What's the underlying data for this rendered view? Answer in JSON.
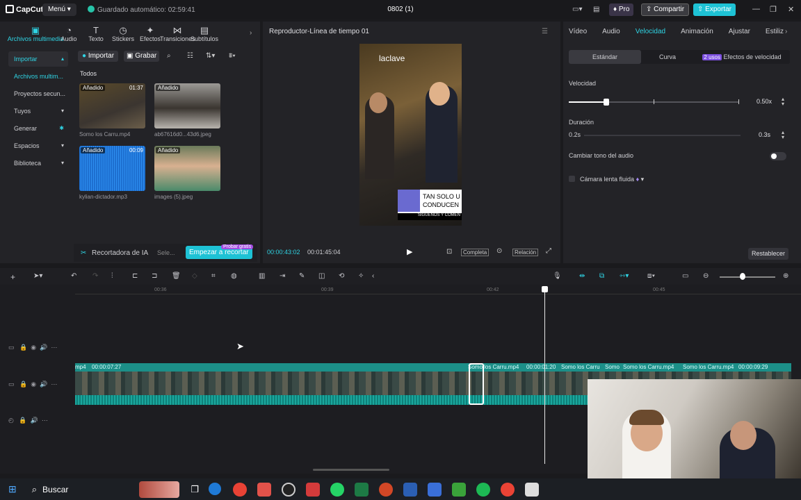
{
  "titlebar": {
    "app_name": "CapCut",
    "menu_label": "Menú",
    "autosave": "Guardado automático: 02:59:41",
    "project_title": "0802 (1)",
    "pro_label": "Pro",
    "share_label": "Compartir",
    "export_label": "Exportar"
  },
  "toolbar_tabs": [
    {
      "label": "Archivos multimedia",
      "icon": "media-icon"
    },
    {
      "label": "Audio",
      "icon": "audio-icon"
    },
    {
      "label": "Texto",
      "icon": "text-icon"
    },
    {
      "label": "Stickers",
      "icon": "sticker-icon"
    },
    {
      "label": "Efectos",
      "icon": "effects-icon"
    },
    {
      "label": "Transiciones",
      "icon": "transition-icon"
    },
    {
      "label": "Subtítulos",
      "icon": "subtitles-icon"
    }
  ],
  "sidebar": {
    "items": [
      {
        "label": "Importar"
      },
      {
        "label": "Archivos multim..."
      },
      {
        "label": "Proyectos secun..."
      },
      {
        "label": "Tuyos"
      },
      {
        "label": "Generar"
      },
      {
        "label": "Espacios"
      },
      {
        "label": "Biblioteca"
      }
    ]
  },
  "media": {
    "import_label": "Importar",
    "record_label": "Grabar",
    "filter_all": "Todos",
    "items": [
      {
        "label": "Somo los Carru.mp4",
        "tag": "Añadido",
        "duration": "01:37"
      },
      {
        "label": "ab67616d0...43d6.jpeg",
        "tag": "Añadido",
        "duration": ""
      },
      {
        "label": "kylian-dictador.mp3",
        "tag": "Añadido",
        "duration": "00:09"
      },
      {
        "label": "images (5).jpeg",
        "tag": "Añadido",
        "duration": ""
      }
    ]
  },
  "ai_bar": {
    "label": "Recortadora de IA",
    "select_label": "Sele...",
    "cut_label": "Empezar a recortar",
    "promo": "Probar gratis"
  },
  "player": {
    "title": "Reproductor-Línea de tiempo 01",
    "current_time": "00:00:43:02",
    "total_time": "00:01:45:04",
    "full_label": "Completa",
    "ratio_label": "Relación",
    "overlay_brand": "laclave",
    "overlay_text1": "TAN SOLO U",
    "overlay_text2": "CONDUCEN",
    "overlay_text3": "SIGUENOS Y COMEN"
  },
  "right_panel": {
    "tabs": [
      {
        "label": "Vídeo"
      },
      {
        "label": "Audio"
      },
      {
        "label": "Velocidad"
      },
      {
        "label": "Animación"
      },
      {
        "label": "Ajustar"
      },
      {
        "label": "Estiliz"
      }
    ],
    "subtabs": {
      "standard": "Estándar",
      "curve": "Curva",
      "uses_badge": "2 usos",
      "speed_effects": "Efectos de velocidad"
    },
    "speed_label": "Velocidad",
    "speed_value": "0.50x",
    "duration_label": "Duración",
    "duration_start": "0.2s",
    "duration_value": "0.3s",
    "pitch_label": "Cambiar tono del audio",
    "slowmo_label": "Cámara lenta fluida",
    "reset_label": "Restablecer"
  },
  "timeline": {
    "ruler": [
      "00:36",
      "00:39",
      "00:42",
      "00:45"
    ],
    "clip_labels": [
      "mp4",
      "00:00:07:27",
      "Somo los Carru.mp4",
      "00:00:01:20",
      "Somo los Carru",
      "Somo",
      "Somo los Carru.mp4",
      "Somo los Carru.mp4",
      "00:00:09:29"
    ]
  },
  "taskbar": {
    "search_label": "Buscar"
  },
  "colors": {
    "accent": "#2fd3e3",
    "clip": "#0f8a83",
    "export": "#1ec2d5"
  }
}
